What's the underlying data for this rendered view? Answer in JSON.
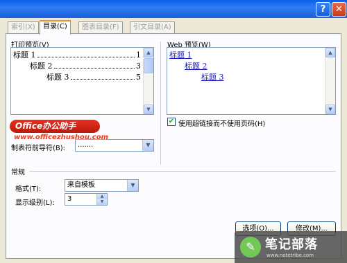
{
  "tabs": [
    {
      "label": "索引(X)"
    },
    {
      "label": "目录(C)"
    },
    {
      "label": "图表目录(F)"
    },
    {
      "label": "引文目录(A)"
    }
  ],
  "print_preview": {
    "label": "打印预览(V)",
    "entries": [
      {
        "text": "标题 1",
        "page": "1"
      },
      {
        "text": "标题 2",
        "page": "3"
      },
      {
        "text": "标题 3",
        "page": "5"
      }
    ]
  },
  "web_preview": {
    "label": "Web 预览(W)",
    "entries": [
      {
        "text": "标题 1"
      },
      {
        "text": "标题 2"
      },
      {
        "text": "标题 3"
      }
    ]
  },
  "options": {
    "hyperlink_label": "使用超链接而不使用页码(H)",
    "hyperlink_checked": true,
    "tab_leader_label": "制表符前导符(B):",
    "tab_leader_value": "......."
  },
  "general": {
    "group_label": "常规",
    "format_label": "格式(T):",
    "format_value": "来自模板",
    "levels_label": "显示级别(L):",
    "levels_value": "3"
  },
  "buttons": {
    "options": "选项(O)...",
    "modify": "修改(M)..."
  },
  "watermarks": {
    "office_brand": "Office办公助手",
    "office_url": "www.officezhushou.com",
    "notes_brand": "笔记部落",
    "notes_url": "www.notetribe.com"
  }
}
